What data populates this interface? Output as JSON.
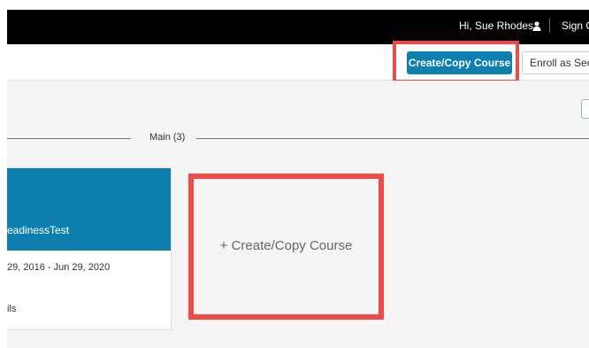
{
  "topbar": {
    "greeting": "Hi, Sue Rhodes",
    "user_icon": "user-icon",
    "signout_label": "Sign O"
  },
  "toolbar": {
    "create_copy_label": "Create/Copy Course",
    "enroll_label": "Enroll as Sect"
  },
  "main": {
    "section_label": "Main (3)",
    "course": {
      "name": "eadinessTest",
      "dates": "29, 2016 - Jun 29, 2020",
      "details_link": "ils"
    },
    "create_card_label": "+ Create/Copy Course"
  },
  "colors": {
    "brand_blue": "#0e7fae",
    "highlight_red": "#ee4b4b",
    "topbar_black": "#000000",
    "content_bg": "#f5f5f5"
  }
}
